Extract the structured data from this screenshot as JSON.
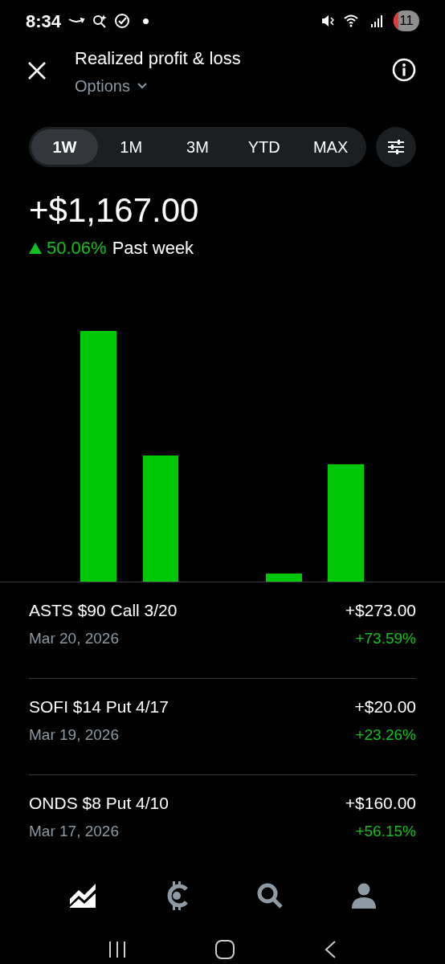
{
  "status_bar": {
    "time": "8:34",
    "battery": "11"
  },
  "header": {
    "title": "Realized profit & loss",
    "subtitle": "Options"
  },
  "ranges": [
    {
      "label": "1W",
      "selected": true
    },
    {
      "label": "1M",
      "selected": false
    },
    {
      "label": "3M",
      "selected": false
    },
    {
      "label": "YTD",
      "selected": false
    },
    {
      "label": "MAX",
      "selected": false
    }
  ],
  "summary": {
    "amount": "+$1,167.00",
    "change": "50.06%",
    "rising": true,
    "period": "Past week"
  },
  "trades": [
    {
      "name": "ASTS $90 Call 3/20",
      "date": "Mar 20, 2026",
      "amount": "+$273.00",
      "percent": "+73.59%"
    },
    {
      "name": "SOFI $14 Put 4/17",
      "date": "Mar 19, 2026",
      "amount": "+$20.00",
      "percent": "+23.26%"
    },
    {
      "name": "ONDS $8 Put 4/10",
      "date": "Mar 17, 2026",
      "amount": "+$160.00",
      "percent": "+56.15%"
    }
  ],
  "bottom_nav": [
    {
      "kind": "portfolio",
      "selected": true
    },
    {
      "kind": "crypto",
      "selected": false
    },
    {
      "kind": "search",
      "selected": false
    },
    {
      "kind": "account",
      "selected": false
    }
  ]
}
